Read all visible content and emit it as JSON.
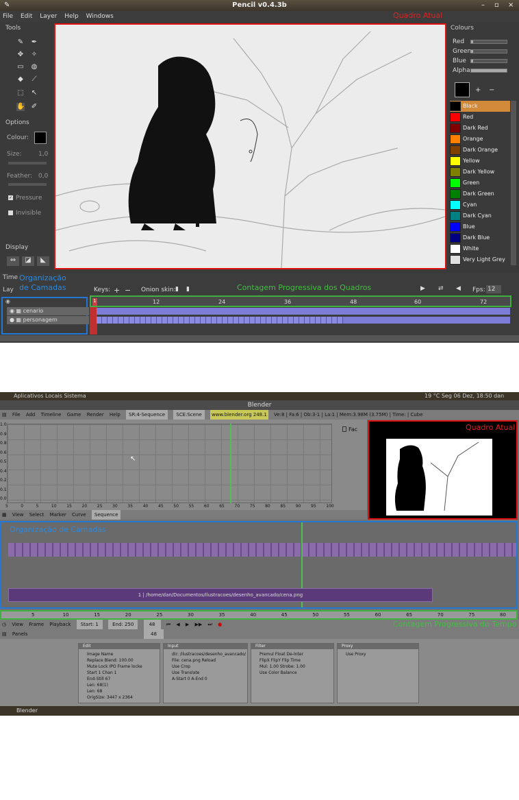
{
  "pencil": {
    "title": "Pencil v0.4.3b",
    "window_controls": [
      "–",
      "▫",
      "×"
    ],
    "menu": [
      "File",
      "Edit",
      "Layer",
      "Help",
      "Windows"
    ],
    "tools_title": "Tools",
    "options_title": "Options",
    "colour_label": "Colour:",
    "size_label": "Size:",
    "size_value": "1,0",
    "feather_label": "Feather:",
    "feather_value": "0,0",
    "pressure_label": "Pressure",
    "invisible_label": "Invisible",
    "display_title": "Display",
    "canvas_annotation": "Quadro Atual",
    "colours_title": "Colours",
    "sliders": [
      {
        "label": "Red",
        "value": 0.05
      },
      {
        "label": "Green",
        "value": 0.05
      },
      {
        "label": "Blue",
        "value": 0.05
      },
      {
        "label": "Alpha",
        "value": 1.0
      }
    ],
    "swatches": [
      {
        "name": "Black",
        "color": "#000000"
      },
      {
        "name": "Red",
        "color": "#ff0000"
      },
      {
        "name": "Dark Red",
        "color": "#800000"
      },
      {
        "name": "Orange",
        "color": "#ff8000"
      },
      {
        "name": "Dark Orange",
        "color": "#804000"
      },
      {
        "name": "Yellow",
        "color": "#ffff00"
      },
      {
        "name": "Dark Yellow",
        "color": "#808000"
      },
      {
        "name": "Green",
        "color": "#00ff00"
      },
      {
        "name": "Dark Green",
        "color": "#008000"
      },
      {
        "name": "Cyan",
        "color": "#00ffff"
      },
      {
        "name": "Dark Cyan",
        "color": "#008080"
      },
      {
        "name": "Blue",
        "color": "#0000ff"
      },
      {
        "name": "Dark Blue",
        "color": "#000080"
      },
      {
        "name": "White",
        "color": "#ffffff"
      },
      {
        "name": "Very Light Grey",
        "color": "#e0e0e0"
      }
    ],
    "timeline_title": "Time",
    "layers_short": "Lay",
    "layers_annotation_1": "Organização",
    "layers_annotation_2": "de Camadas",
    "keys_label": "Keys:",
    "onion_label": "Onion skin:",
    "frames_annotation": "Contagem Progressiva dos Quadros",
    "fps_label": "Fps:",
    "fps_value": "12",
    "frame_ticks": [
      "12",
      "24",
      "36",
      "48",
      "60",
      "72"
    ],
    "current_frame": "1",
    "layers": [
      "cenario",
      "personagem"
    ]
  },
  "blender": {
    "top_menu": "Aplicativos  Locais  Sistema",
    "top_status": "19 °C  Seg 06 Dez, 18:50  dan",
    "title": "Blender",
    "header_menu": [
      "File",
      "Add",
      "Timeline",
      "Game",
      "Render",
      "Help"
    ],
    "sr_field": "SR:4-Sequence",
    "sce_field": "SCE:Scene",
    "url": "www.blender.org 248.1",
    "stats": "Ve:8 | Fa:6 | Ob:3-1 | La:1  | Mem:3.98M (3.75M) | Time: | Cube",
    "ipo_y_ticks": [
      "1.0",
      "0.9",
      "0.8",
      "0.6",
      "0.5",
      "0.4",
      "0.2",
      "0.1",
      "0.0"
    ],
    "ipo_x_ticks": [
      "5",
      "0",
      "5",
      "10",
      "15",
      "20",
      "25",
      "30",
      "35",
      "40",
      "45",
      "50",
      "55",
      "60",
      "65",
      "70",
      "75",
      "80",
      "85",
      "90",
      "95",
      "100"
    ],
    "fac_label": "Fac",
    "preview_annotation": "Quadro Atual",
    "ipo_header": [
      "View",
      "Select",
      "Marker",
      "Curve"
    ],
    "ipo_sequence": "Sequence",
    "seq_annotation": "Organização de Camadas",
    "strip_label": "1 | /home/dan/Documentos/ilustracoes/desenho_avancado/cena.png",
    "ruler_ticks": [
      "5",
      "10",
      "15",
      "20",
      "25",
      "30",
      "35",
      "40",
      "45",
      "50",
      "55",
      "60",
      "65",
      "70",
      "75",
      "80"
    ],
    "seq_header": [
      "View",
      "Frame",
      "Playback"
    ],
    "start_label": "Start: 1",
    "end_label": "End: 250",
    "current_frame": "48",
    "time_annotation": "Contagem Progressiva do Tempo",
    "panels_label": "Panels",
    "frame_field": "48",
    "edit_panel": "Edit",
    "input_panel": "Input",
    "filter_panel": "Filter",
    "proxy_panel": "Proxy",
    "edit_lines": [
      "Image  Name",
      "Replace  Blend: 100.00",
      "Mute  Lock  IPO Frame locke",
      "Start 1  Chan 1",
      "End-Still 67",
      "Len: 68(1)",
      "Len: 68",
      "OrigSize: 3447 x 2364"
    ],
    "input_lines": [
      "dir: /ilustracoes/desenho_avancado/",
      "File: cena.png  Reload",
      "Use Crop",
      "Use Translate",
      "A-Start 0  A-End 0"
    ],
    "filter_lines": [
      "Premul  Float  De-Inter",
      "FlipX  FlipY  Flip Time",
      "Mul: 1.00  Strobe: 1.00",
      "Use Color Balance"
    ],
    "proxy_lines": [
      "Use Proxy"
    ],
    "taskbar": "Blender"
  }
}
